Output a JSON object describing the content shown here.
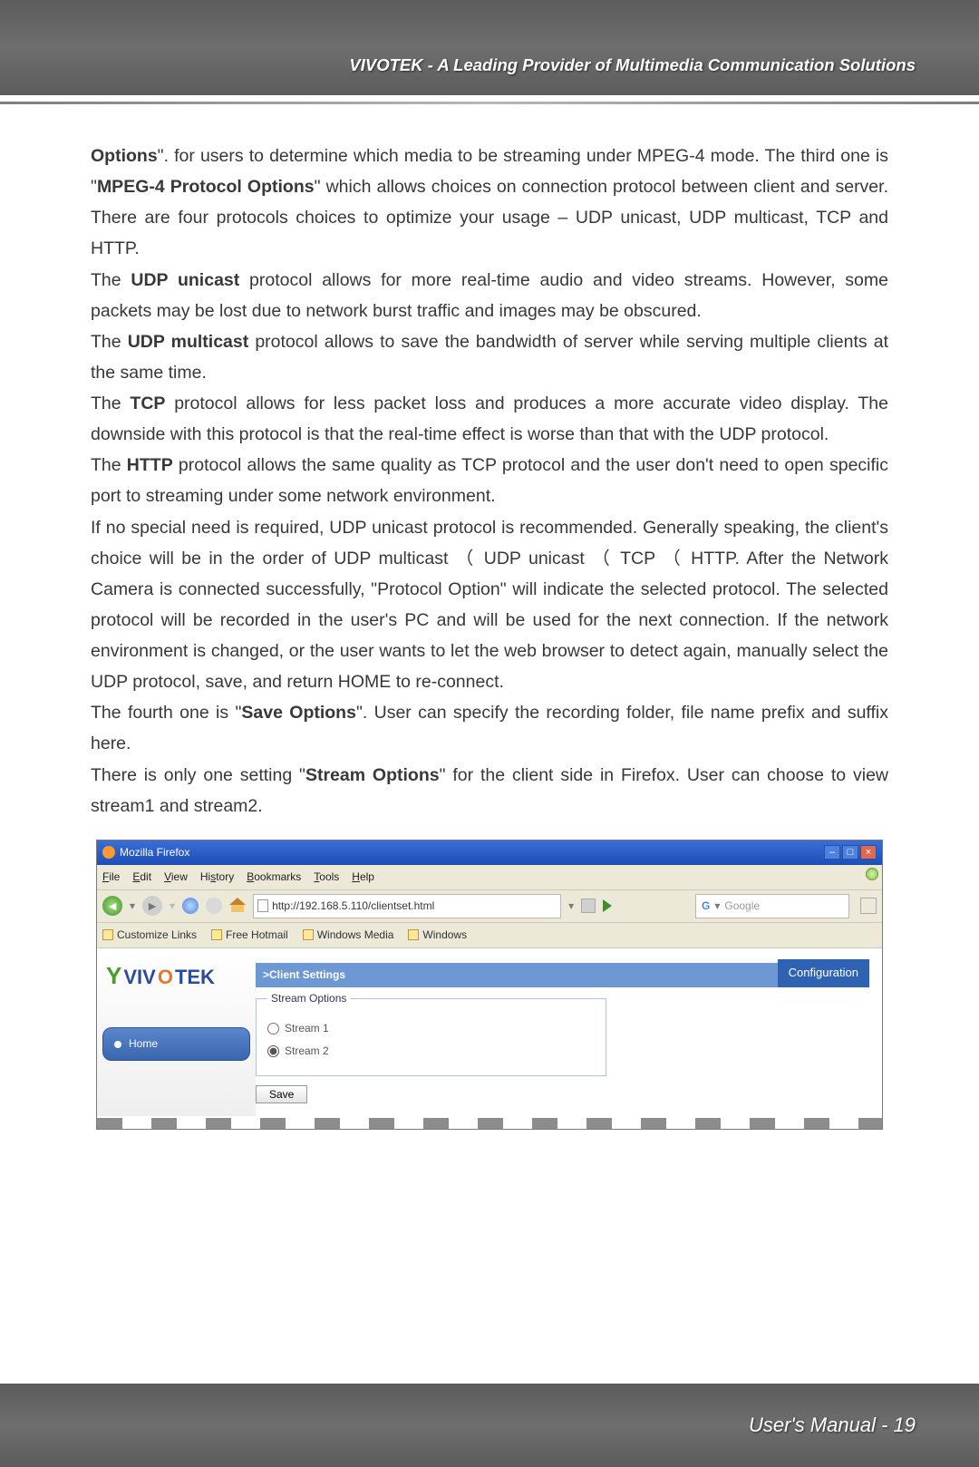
{
  "header": {
    "title": "VIVOTEK - A Leading Provider of Multimedia Communication Solutions"
  },
  "body": {
    "p1a": "Options",
    "p1b": "\". for users to determine which media to be streaming under MPEG-4 mode. The third one is \"",
    "p1c": "MPEG-4 Protocol Options",
    "p1d": "\" which allows choices on connection protocol between client and server. There are four protocols choices to optimize your usage – UDP unicast, UDP multicast, TCP and HTTP.",
    "p2a": "The ",
    "p2b": "UDP unicast",
    "p2c": " protocol allows for more real-time audio and video streams. However, some packets may be lost due to network burst traffic and images may be obscured.",
    "p3a": "The ",
    "p3b": "UDP multicast",
    "p3c": " protocol allows to save the bandwidth of server while serving multiple clients at the same time.",
    "p4a": "The ",
    "p4b": "TCP",
    "p4c": " protocol allows for less packet loss and produces a more accurate video display. The downside with this protocol is that the real-time effect is worse than that with the UDP protocol.",
    "p5a": "The ",
    "p5b": "HTTP",
    "p5c": " protocol allows the same quality as TCP protocol and the user don't need to open specific port to streaming under some network environment.",
    "p6": "If no special need is required, UDP unicast protocol is recommended. Generally speaking, the client's choice will be in the order of UDP multicast （ UDP unicast （ TCP （ HTTP.  After the Network Camera is connected successfully, \"Protocol Option\" will indicate the selected protocol. The selected protocol will be recorded in the user's PC and will be used for the next connection. If the network environment is changed, or the user wants to let the web browser to detect again, manually select the UDP protocol, save, and return HOME to re-connect.",
    "p7a": "The fourth one is \"",
    "p7b": "Save Options",
    "p7c": "\". User can specify the recording folder, file name prefix and suffix here.",
    "p8a": "There is only one setting \"",
    "p8b": "Stream Options",
    "p8c": "\" for the client side in Firefox. User can choose to view stream1 and stream2."
  },
  "screenshot": {
    "title": "Mozilla Firefox",
    "menus": {
      "file": "File",
      "edit": "Edit",
      "view": "View",
      "history": "History",
      "bookmarks": "Bookmarks",
      "tools": "Tools",
      "help": "Help"
    },
    "url": "http://192.168.5.110/clientset.html",
    "search_placeholder": "Google",
    "bookmarks": {
      "b1": "Customize Links",
      "b2": "Free Hotmail",
      "b3": "Windows Media",
      "b4": "Windows"
    },
    "logo": {
      "brand_pre": "VIV",
      "brand_mid": "O",
      "brand_post": "TEK"
    },
    "home": "Home",
    "config": "Configuration",
    "client_settings": ">Client Settings",
    "stream_options": "Stream Options",
    "stream1": "Stream 1",
    "stream2": "Stream 2",
    "save": "Save"
  },
  "footer": {
    "text": "User's Manual - 19"
  }
}
